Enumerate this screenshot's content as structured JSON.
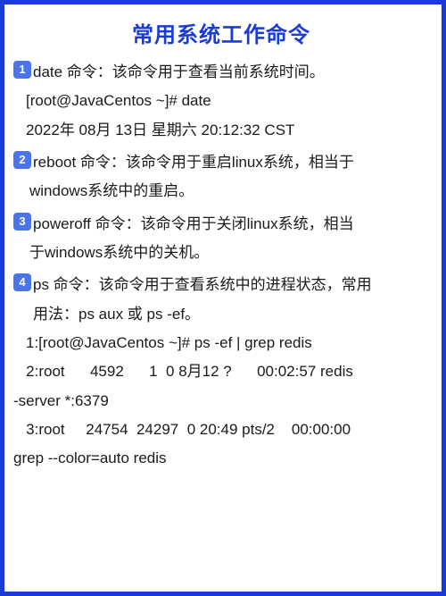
{
  "title": "常用系统工作命令",
  "items": [
    {
      "num": "1",
      "head": "date 命令：该命令用于查看当前系统时间。",
      "lines": [
        "[root@JavaCentos ~]# date",
        "2022年 08月 13日 星期六 20:12:32 CST"
      ]
    },
    {
      "num": "2",
      "head": "reboot 命令：该命令用于重启linux系统，相当于",
      "cont": "windows系统中的重启。"
    },
    {
      "num": "3",
      "head": "poweroff 命令：该命令用于关闭linux系统，相当",
      "cont": "于windows系统中的关机。"
    },
    {
      "num": "4",
      "head": "ps 命令：该命令用于查看系统中的进程状态，常用",
      "cont_indent": "用法：ps aux 或 ps -ef。",
      "out1": "1:[root@JavaCentos ~]# ps -ef | grep redis",
      "out2": "   2:root      4592      1  0 8月12 ?      00:02:57 redis",
      "out2b": "-server *:6379",
      "out3": "   3:root     24754  24297  0 20:49 pts/2    00:00:00",
      "out3b": "grep --color=auto redis"
    }
  ]
}
